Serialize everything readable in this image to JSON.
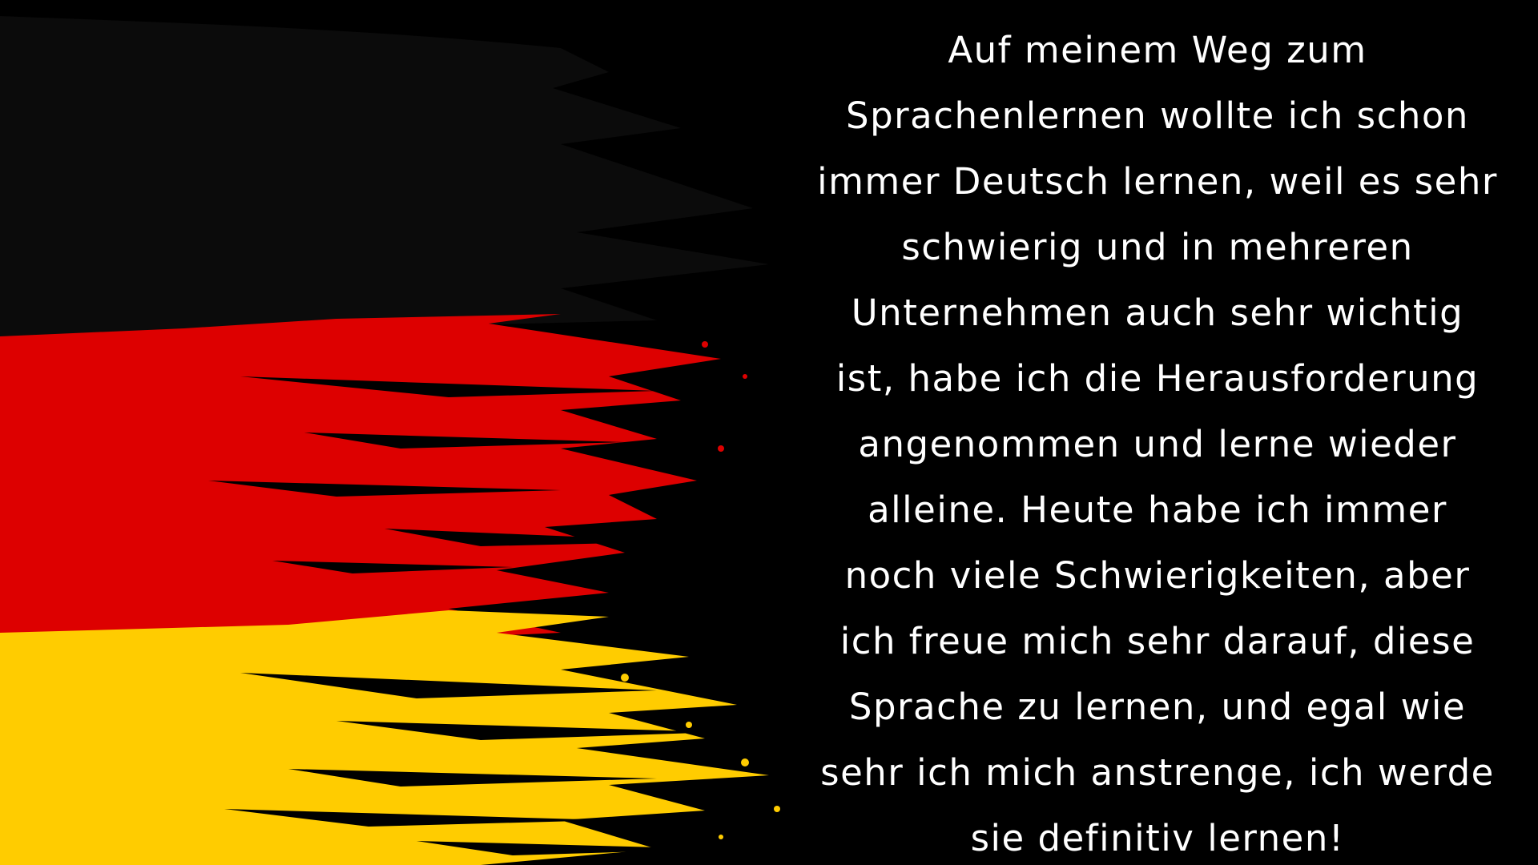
{
  "colors": {
    "background": "#000000",
    "flag_black": "#0b0b0b",
    "flag_red": "#dd0000",
    "flag_gold": "#ffcc00",
    "text": "#ffffff"
  },
  "paragraph": {
    "text": "Auf meinem Weg zum\nSprachenlernen wollte ich schon\nimmer Deutsch lernen, weil es sehr\nschwierig und in mehreren\nUnternehmen auch sehr wichtig\nist, habe ich die Herausforderung\nangenommen und lerne wieder\nalleine. Heute habe ich immer\nnoch viele Schwierigkeiten, aber\nich freue mich sehr darauf, diese\nSprache zu lernen, und egal wie\nsehr ich mich anstrenge, ich werde\nsie definitiv lernen!"
  }
}
